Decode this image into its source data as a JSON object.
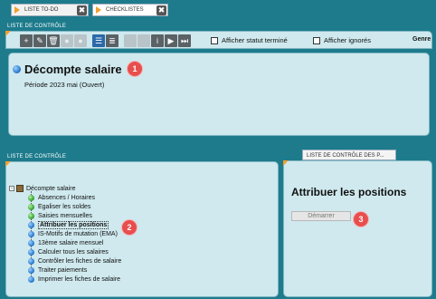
{
  "tabs": [
    {
      "label": "LISTE TO-DO",
      "close": "✖"
    },
    {
      "label": "CHECKLISTES",
      "close": "✖"
    }
  ],
  "top_panel": {
    "title": "LISTE DE CONTRÔLE",
    "toolbar_icons": [
      "plus-icon",
      "edit-icon",
      "trash-icon",
      "disabled-icon",
      "disabled-icon",
      "list-detail-icon",
      "list-icon",
      "disabled-icon",
      "disabled-icon",
      "info-icon",
      "play-icon",
      "skip-end-icon"
    ],
    "show_finished_label": "Afficher statut terminé",
    "show_ignored_label": "Afficher ignorés",
    "genre_label": "Genre",
    "record_title": "Décompte salaire",
    "period": "Période 2023  mai (Ouvert)"
  },
  "tree_panel": {
    "title": "LISTE DE CONTRÔLE",
    "root": "Décompte salaire",
    "items": [
      {
        "label": "Absences / Horaires",
        "status": "green"
      },
      {
        "label": "Egaliser les soldes",
        "status": "green"
      },
      {
        "label": "Saisies mensuelles",
        "status": "green"
      },
      {
        "label": "Attribuer les positions",
        "status": "blue",
        "selected": true
      },
      {
        "label": "IS-Motifs de mutation (EMA)",
        "status": "blue"
      },
      {
        "label": "13ème salaire mensuel",
        "status": "blue"
      },
      {
        "label": "Calculer tous les salaires",
        "status": "blue"
      },
      {
        "label": "Contrôler les fiches de salaire",
        "status": "blue"
      },
      {
        "label": "Traiter paiements",
        "status": "blue"
      },
      {
        "label": "Imprimer les fiches de salaire",
        "status": "blue"
      }
    ]
  },
  "right_panel": {
    "tab_label": "LISTE DE CONTRÔLE DES P...",
    "heading": "Attribuer les positions",
    "start_button": "Démarrer"
  },
  "badges": [
    "1",
    "2",
    "3"
  ],
  "colors": {
    "background": "#1d7b8c",
    "panel": "#cfe9ee",
    "accent": "#f0a030",
    "badge": "#e84e4e"
  }
}
